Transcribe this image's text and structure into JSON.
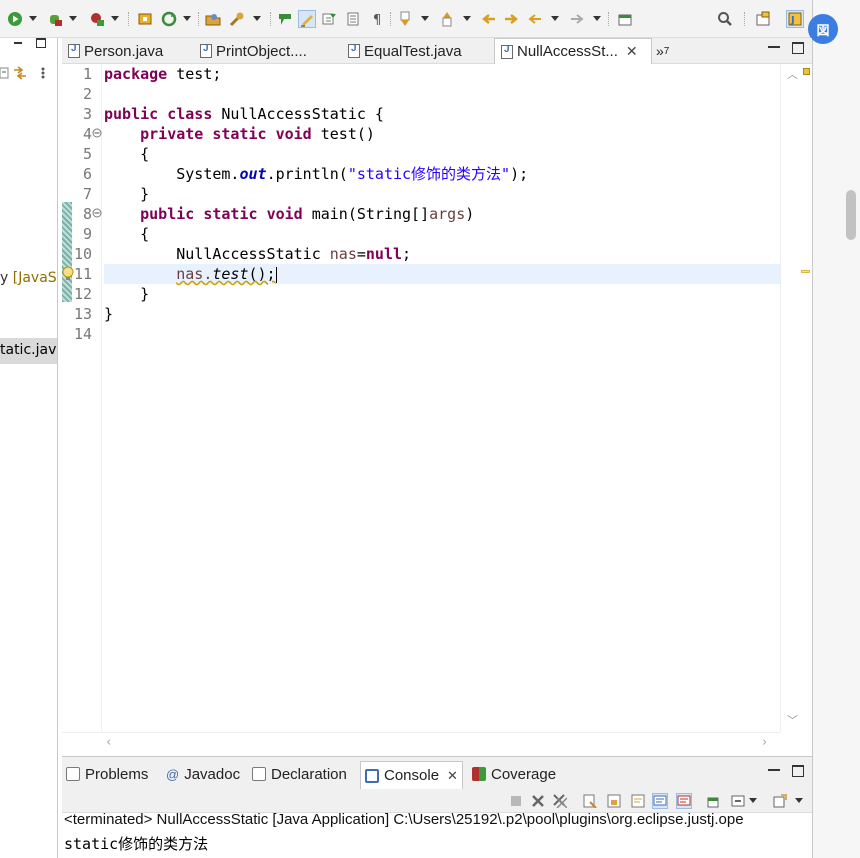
{
  "toolbar": {
    "icons": [
      "run-icon",
      "debug-icon",
      "coverage-icon",
      "new-icon",
      "refresh-icon",
      "open-type-icon",
      "search-icon-tool",
      "highlight-icon",
      "toggle-mark-icon",
      "show-whitespace-icon",
      "next-annotation-icon",
      "prev-annotation-icon",
      "back-icon",
      "forward-icon",
      "pin-icon",
      "search-icon",
      "open-perspective-icon",
      "java-perspective-icon"
    ]
  },
  "left_panel": {
    "java_label_prefix": "y ",
    "java_label_dim": "[JavaSE",
    "selected_file": "tatic.jav"
  },
  "editor": {
    "tabs": [
      {
        "label": "Person.java",
        "active": false
      },
      {
        "label": "PrintObject....",
        "active": false
      },
      {
        "label": "EqualTest.java",
        "active": false
      },
      {
        "label": "NullAccessSt...",
        "active": true
      }
    ],
    "overflow_label": "»",
    "overflow_count": "7",
    "line_numbers": [
      "1",
      "2",
      "3",
      "4",
      "5",
      "6",
      "7",
      "8",
      "9",
      "10",
      "11",
      "12",
      "13",
      "14"
    ],
    "fold_markers": [
      "4",
      "8"
    ],
    "code": {
      "l1_kw": "package",
      "l1_rest": " test;",
      "l3_kw1": "public",
      "l3_kw2": "class",
      "l3_rest": " NullAccessStatic {",
      "l4_kw1": "private",
      "l4_kw2": "static",
      "l4_kw3": "void",
      "l4_rest": " test()",
      "l5": "{",
      "l6_pre": "System.",
      "l6_field": "out",
      "l6_mid": ".println(",
      "l6_str": "\"static修饰的类方法\"",
      "l6_end": ");",
      "l7": "}",
      "l8_kw1": "public",
      "l8_kw2": "static",
      "l8_kw3": "void",
      "l8_mid": " main(String[]",
      "l8_var": "args",
      "l8_end": ")",
      "l9": "{",
      "l10_type": "NullAccessStatic ",
      "l10_var": "nas",
      "l10_eq": "=",
      "l10_kw": "null",
      "l10_end": ";",
      "l11_var": "nas.",
      "l11_call": "test",
      "l11_end": "();",
      "l12": "}",
      "l13": "}"
    }
  },
  "bottom_panel": {
    "tabs": [
      {
        "label": "Problems",
        "active": false
      },
      {
        "label": "Javadoc",
        "active": false
      },
      {
        "label": "Declaration",
        "active": false
      },
      {
        "label": "Console",
        "active": true
      },
      {
        "label": "Coverage",
        "active": false
      }
    ],
    "terminated_line": "<terminated> NullAccessStatic [Java Application] C:\\Users\\25192\\.p2\\pool\\plugins\\org.eclipse.justj.ope",
    "output": "static修饰的类方法"
  },
  "badge_text": "図"
}
